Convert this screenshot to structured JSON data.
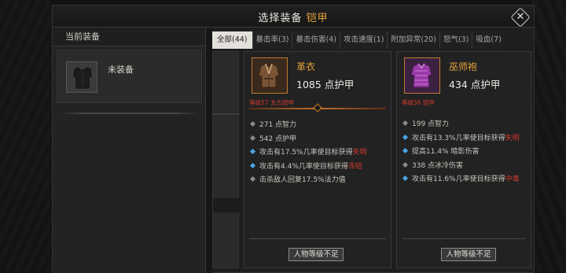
{
  "window": {
    "title_prefix": "选择装备",
    "title_highlight": "铠甲",
    "close_icon": "close-x-diamond-icon"
  },
  "left_panel": {
    "header": "当前装备",
    "current_item": {
      "icon": "armor-silhouette-icon",
      "label": "未装备"
    }
  },
  "tabs": [
    {
      "label": "全部(44)",
      "active": true
    },
    {
      "label": "暴击率(3)"
    },
    {
      "label": "暴击伤害(4)"
    },
    {
      "label": "攻击速度(1)"
    },
    {
      "label": "附加异常(20)"
    },
    {
      "label": "怒气(3)"
    },
    {
      "label": "吸血(7)"
    }
  ],
  "cards": [
    {
      "icon": "leather-coat-icon",
      "name": "革衣",
      "armor": "1085 点护甲",
      "requirement": "等级57 太古铠甲",
      "stats": [
        {
          "bullet": "gray",
          "text": "271 点智力"
        },
        {
          "bullet": "gray",
          "text": "542 点护甲"
        },
        {
          "bullet": "blue",
          "text": "攻击有17.5%几率使目标获得",
          "red": "失明"
        },
        {
          "bullet": "blue",
          "text": "攻击有4.4%几率使目标获得",
          "red": "冻结"
        },
        {
          "bullet": "gray",
          "text": "击杀敌人回复17.5%法力值"
        }
      ],
      "button": "人物等级不足"
    },
    {
      "icon": "wizard-robe-icon",
      "name": "巫师袍",
      "armor": "434 点护甲",
      "requirement": "等级56 铠甲",
      "stats": [
        {
          "bullet": "gray",
          "text": "199 点智力"
        },
        {
          "bullet": "blue",
          "text": "攻击有13.3%几率使目标获得",
          "red": "失明"
        },
        {
          "bullet": "blue",
          "text": "提高11.4% 暗影伤害"
        },
        {
          "bullet": "gray",
          "text": "338 点冰冷伤害"
        },
        {
          "bullet": "blue",
          "text": "攻击有11.6%几率使目标获得",
          "red": "中毒"
        }
      ],
      "button": "人物等级不足"
    }
  ],
  "colors": {
    "accent_orange": "#e8a43a",
    "requirement_red": "#d23a2e",
    "bullet_blue": "#49a5e6"
  }
}
